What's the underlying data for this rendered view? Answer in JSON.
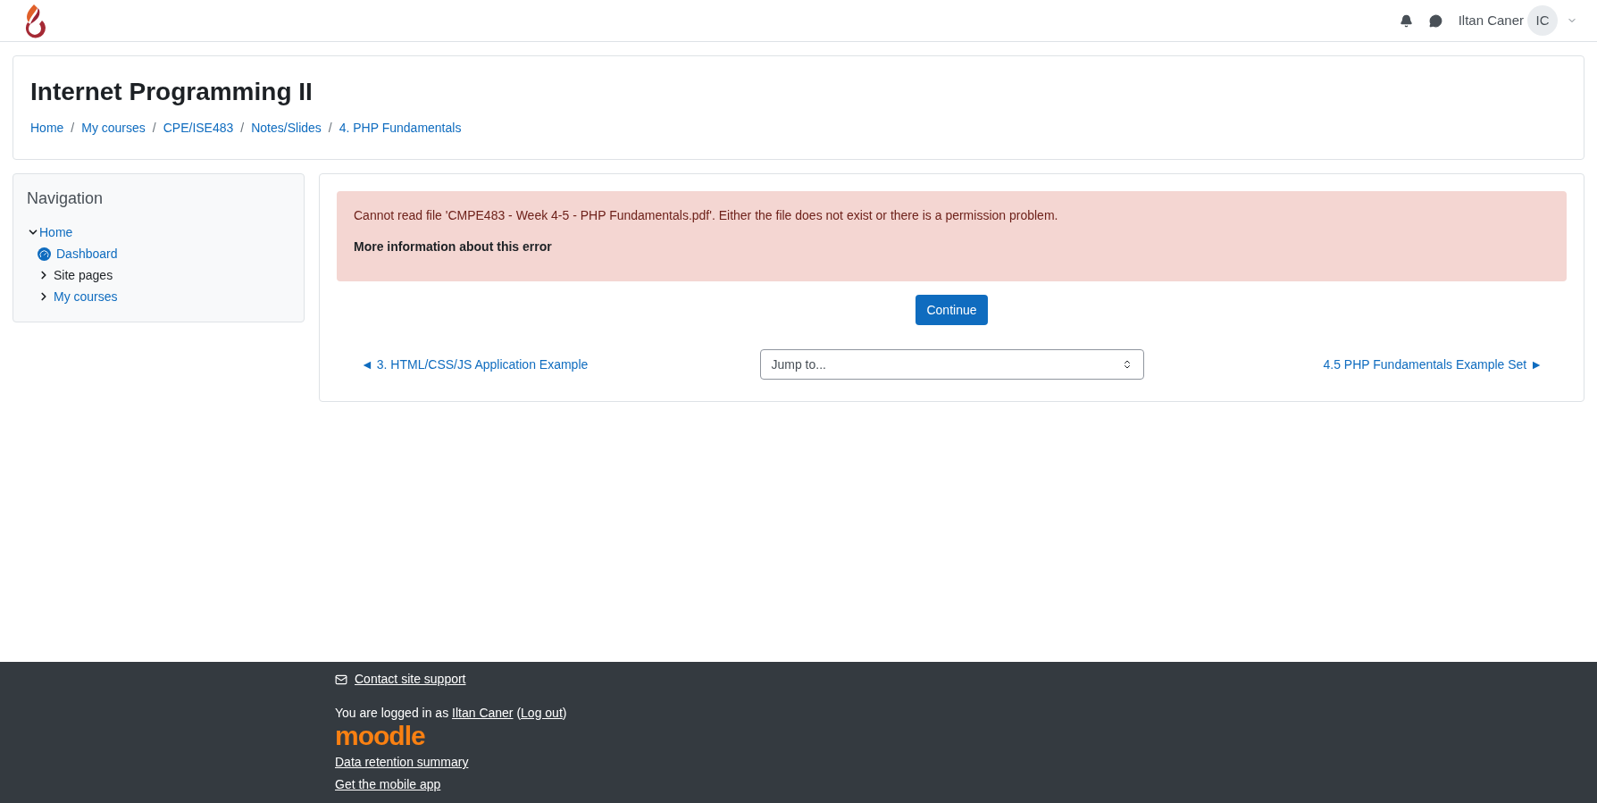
{
  "navbar": {
    "user_name": "Iltan Caner",
    "avatar_initials": "IC"
  },
  "course": {
    "title": "Internet Programming II",
    "breadcrumb": [
      "Home",
      "My courses",
      "CPE/ISE483",
      "Notes/Slides",
      "4. PHP Fundamentals"
    ],
    "separator": "/"
  },
  "navigation": {
    "title": "Navigation",
    "items": [
      {
        "label": "Home",
        "kind": "toggle",
        "link": true,
        "expanded": true,
        "children": [
          {
            "label": "Dashboard",
            "kind": "icon",
            "link": true
          },
          {
            "label": "Site pages",
            "kind": "toggle",
            "link": false,
            "expanded": false
          },
          {
            "label": "My courses",
            "kind": "toggle",
            "link": true,
            "expanded": false
          }
        ]
      }
    ]
  },
  "error": {
    "message": "Cannot read file 'CMPE483 - Week 4-5 - PHP Fundamentals.pdf'. Either the file does not exist or there is a permission problem.",
    "more_info": "More information about this error"
  },
  "continue_button": "Continue",
  "activity_nav": {
    "previous": "◄ 3. HTML/CSS/JS Application Example",
    "jump_placeholder": "Jump to...",
    "next": "4.5 PHP Fundamentals Example Set ►"
  },
  "footer": {
    "contact": "Contact site support",
    "login_prefix": "You are logged in as ",
    "login_user": "Iltan Caner",
    "login_open": " (",
    "logout": "Log out",
    "login_close": ")",
    "logo": "moodle",
    "links": [
      "Data retention summary",
      "Get the mobile app"
    ]
  }
}
